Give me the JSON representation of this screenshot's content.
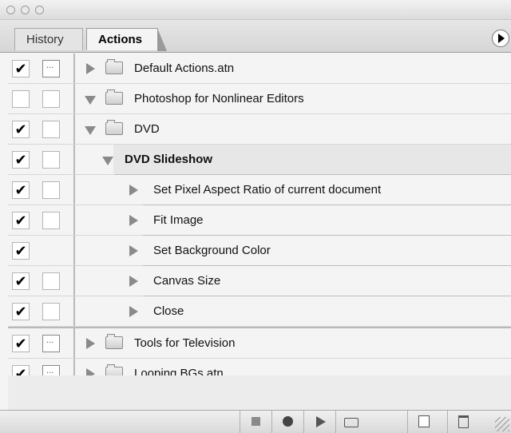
{
  "tabs": {
    "history": "History",
    "actions": "Actions"
  },
  "rows": [
    {
      "label": "Default Actions.atn",
      "checked": true,
      "dialog": true
    },
    {
      "label": "Photoshop for Nonlinear Editors",
      "checked": false,
      "dialog": false
    },
    {
      "label": "DVD",
      "checked": true,
      "dialog": false
    },
    {
      "label": "DVD Slideshow",
      "checked": true,
      "dialog": false
    },
    {
      "label": "Set Pixel Aspect Ratio of current document",
      "checked": true,
      "dialog": false
    },
    {
      "label": "Fit Image",
      "checked": true,
      "dialog": false
    },
    {
      "label": "Set Background Color",
      "checked": true,
      "dialog": false
    },
    {
      "label": "Canvas Size",
      "checked": true,
      "dialog": false
    },
    {
      "label": "Close",
      "checked": true,
      "dialog": false
    },
    {
      "label": "Tools for Television",
      "checked": true,
      "dialog": true
    },
    {
      "label": "Looping BGs.atn",
      "checked": true,
      "dialog": true
    }
  ],
  "checkmark": "✔",
  "icons": [
    "stop-icon",
    "record-icon",
    "play-icon",
    "new-set-icon",
    "new-action-icon",
    "trash-icon"
  ]
}
